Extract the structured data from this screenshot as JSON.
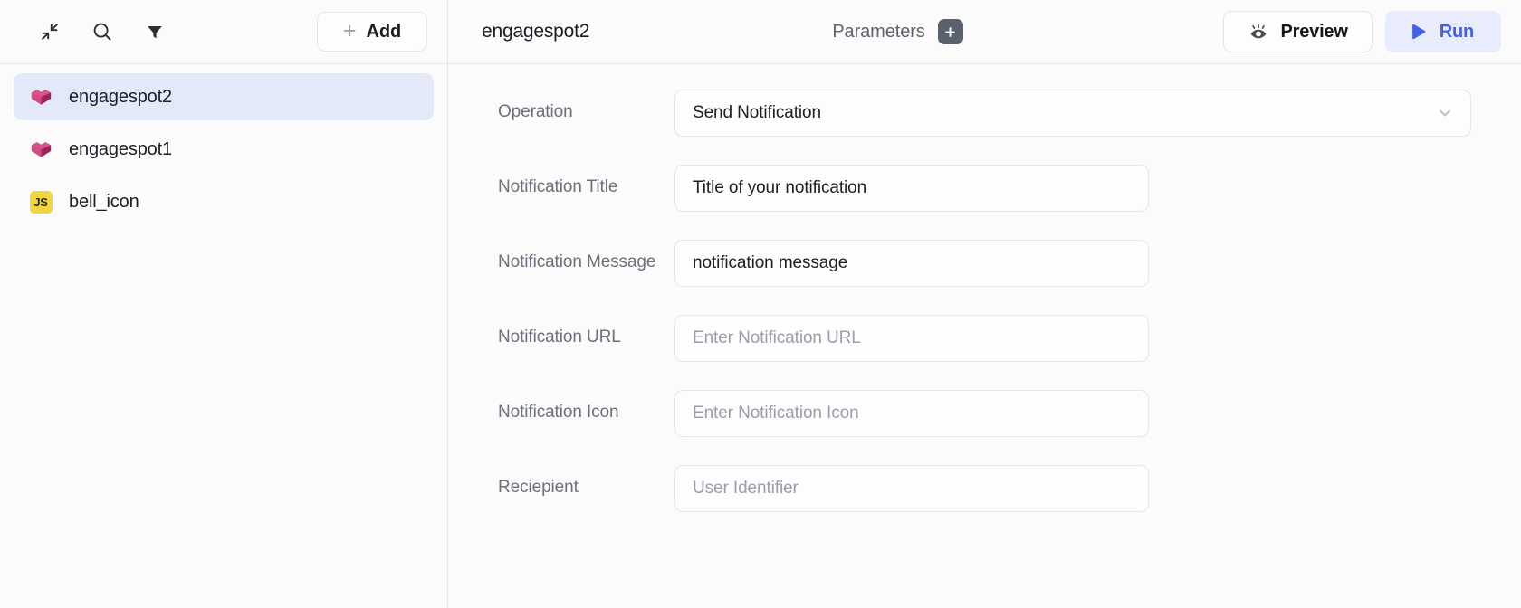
{
  "left_panel": {
    "toolbar": {
      "collapse_icon": "collapse-arrows-icon",
      "search_icon": "search-icon",
      "filter_icon": "filter-funnel-icon",
      "add_label": "Add",
      "add_plus": "+"
    },
    "nodes": [
      {
        "label": "engagespot2",
        "icon": "engagespot-logo-icon",
        "selected": true
      },
      {
        "label": "engagespot1",
        "icon": "engagespot-logo-icon",
        "selected": false
      },
      {
        "label": "bell_icon",
        "icon": "js-badge-icon",
        "badge_text": "JS",
        "selected": false
      }
    ]
  },
  "right_panel": {
    "header": {
      "title": "engagespot2",
      "parameters_label": "Parameters",
      "parameters_add_icon": "plus-icon",
      "preview_label": "Preview",
      "preview_icon": "eye-icon",
      "run_label": "Run",
      "run_icon": "play-icon"
    },
    "form": {
      "fields": [
        {
          "label": "Operation",
          "type": "select",
          "value": "Send Notification",
          "is_placeholder": false,
          "chevron_icon": "chevron-down-icon",
          "name": "operation"
        },
        {
          "label": "Notification Title",
          "type": "text",
          "value": "Title of your notification",
          "is_placeholder": false,
          "name": "notification-title"
        },
        {
          "label": "Notification Message",
          "type": "text",
          "value": "notification message",
          "is_placeholder": false,
          "name": "notification-message"
        },
        {
          "label": "Notification URL",
          "type": "text",
          "value": "Enter Notification URL",
          "is_placeholder": true,
          "name": "notification-url"
        },
        {
          "label": "Notification Icon",
          "type": "text",
          "value": "Enter Notification Icon",
          "is_placeholder": true,
          "name": "notification-icon"
        },
        {
          "label": "Reciepient",
          "type": "text",
          "value": "User Identifier",
          "is_placeholder": true,
          "name": "reciepient"
        }
      ]
    }
  },
  "colors": {
    "accent_blue": "#4560e6",
    "run_bg": "#e8ecfd",
    "selected_item_bg": "#e4e9fa",
    "engagespot_pink": "#c2326e",
    "js_yellow": "#f2d641",
    "page_bg": "#fbfbfc",
    "border": "#e6e7ec",
    "label_gray": "#6c707a",
    "placeholder_gray": "#9a9ea8"
  }
}
